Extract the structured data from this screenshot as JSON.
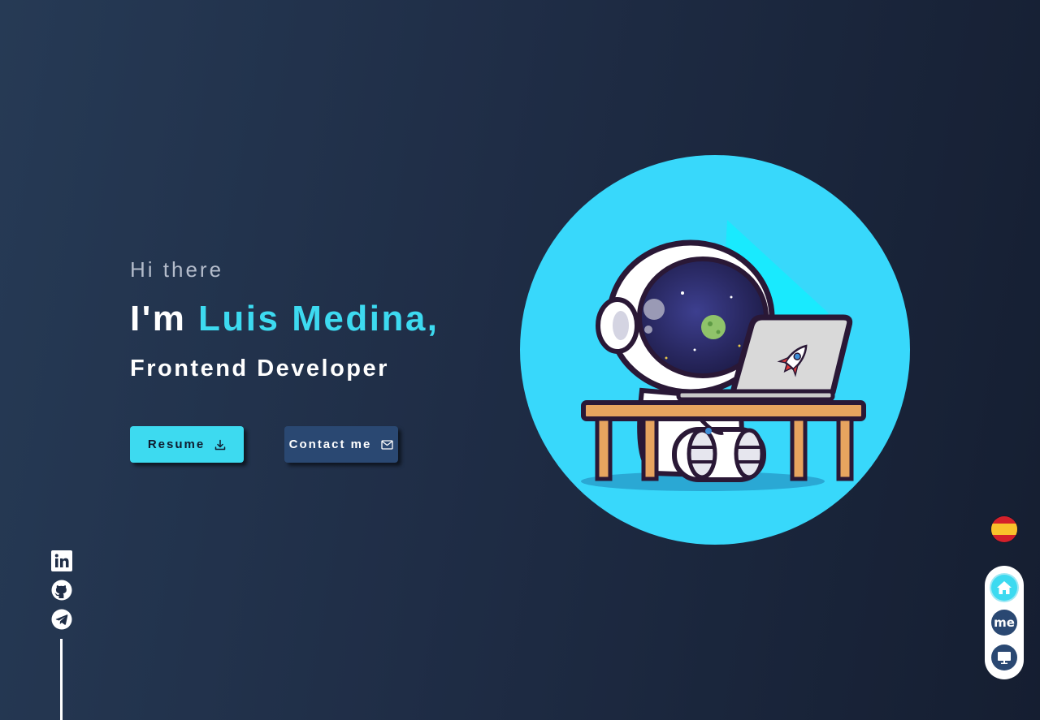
{
  "hero": {
    "greeting": "Hi there",
    "intro": "I'm ",
    "name": "Luis Medina,",
    "role": "Frontend Developer"
  },
  "buttons": {
    "resume_label": "Resume",
    "resume_icon": "download-icon",
    "contact_label": "Contact me",
    "contact_icon": "mail-icon"
  },
  "illustration": {
    "subject": "astronaut-with-laptop-illustration",
    "circle_color": "#38d8fb"
  },
  "social": {
    "items": [
      {
        "icon": "linkedin-icon"
      },
      {
        "icon": "github-icon"
      },
      {
        "icon": "telegram-icon"
      }
    ]
  },
  "language": {
    "icon": "spain-flag-icon"
  },
  "nav": {
    "items": [
      {
        "icon": "home-icon"
      },
      {
        "label": "me"
      },
      {
        "icon": "monitor-icon"
      }
    ]
  },
  "colors": {
    "accent": "#3ddaf0",
    "secondary_button": "#2a4872",
    "text_muted": "#b4bccb"
  }
}
